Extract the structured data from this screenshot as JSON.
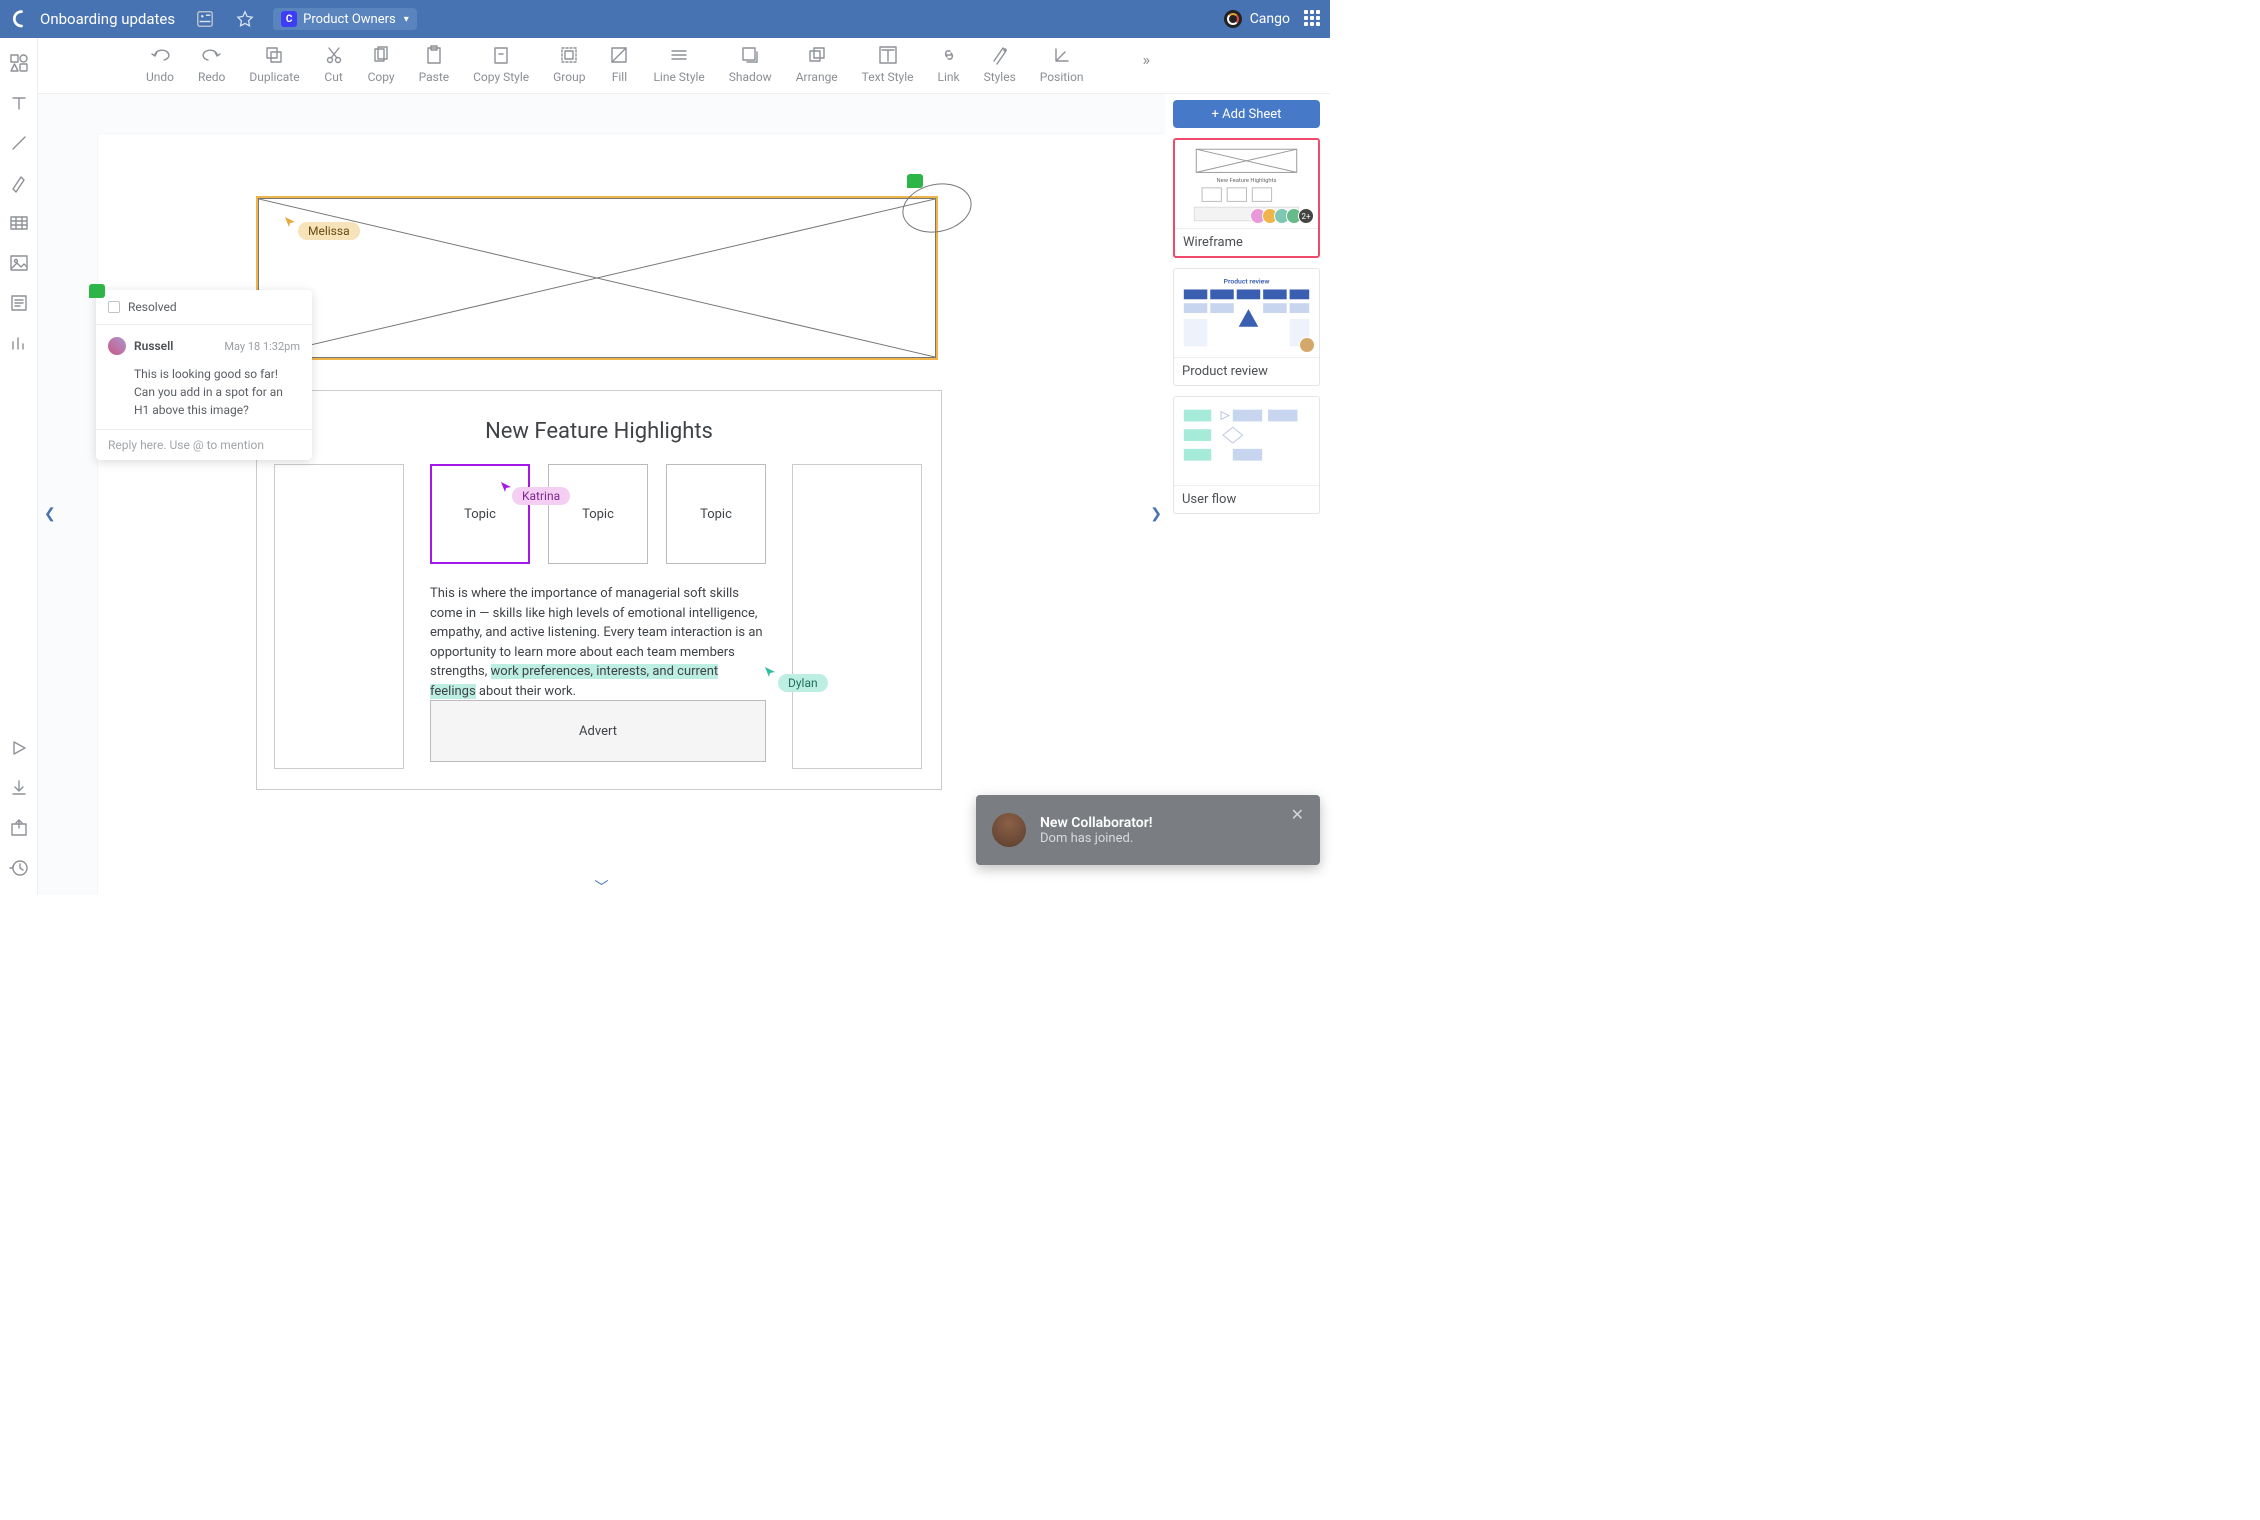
{
  "header": {
    "doc_title": "Onboarding updates",
    "team_label": "Product Owners",
    "brand_name": "Cango"
  },
  "toolbar": {
    "items": [
      "Undo",
      "Redo",
      "Duplicate",
      "Cut",
      "Copy",
      "Paste",
      "Copy Style",
      "Group",
      "Fill",
      "Line Style",
      "Shadow",
      "Arrange",
      "Text Style",
      "Link",
      "Styles",
      "Position"
    ]
  },
  "comment": {
    "resolved_label": "Resolved",
    "author": "Russell",
    "timestamp": "May 18 1:32pm",
    "body": "This is looking good so far! Can you add in a spot for an H1 above this image?",
    "reply_placeholder": "Reply here. Use @ to mention"
  },
  "cursors": {
    "melissa": "Melissa",
    "katrina": "Katrina",
    "dylan": "Dylan"
  },
  "wireframe": {
    "section_title": "New Feature Highlights",
    "topics": [
      "Topic",
      "Topic",
      "Topic"
    ],
    "body_pre": "This is where the importance of managerial soft skills come in — skills like high levels of emotional intelligence, empathy, and active listening. Every team interaction is an opportunity to learn more about each team members strengths, ",
    "body_hl": "work preferences, interests, and current feelings",
    "body_post": " about their work.",
    "advert": "Advert"
  },
  "sheets": {
    "add_label": "+ Add Sheet",
    "cards": [
      {
        "label": "Wireframe",
        "selected": true,
        "avatars": 5
      },
      {
        "label": "Product review",
        "selected": false,
        "avatars": 1
      },
      {
        "label": "User flow",
        "selected": false,
        "avatars": 0
      }
    ]
  },
  "toast": {
    "title": "New Collaborator!",
    "body": "Dom has joined."
  }
}
